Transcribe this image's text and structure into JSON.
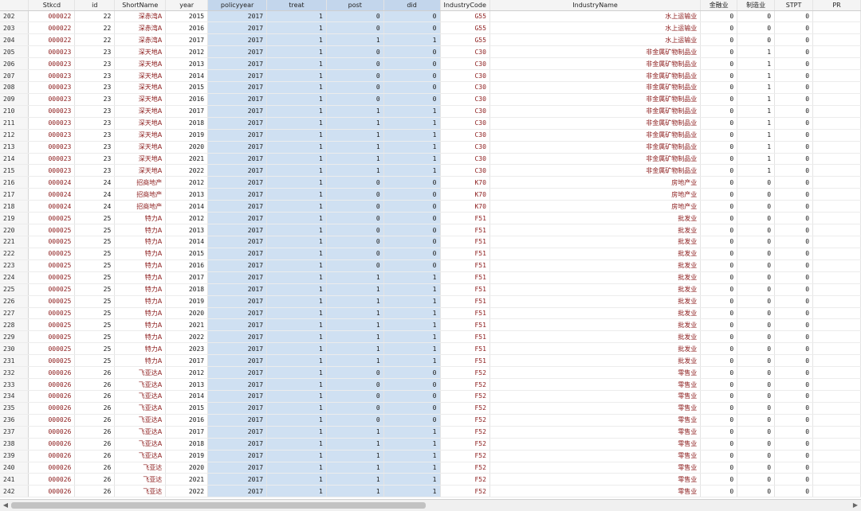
{
  "columns": [
    "",
    "Stkcd",
    "id",
    "ShortName",
    "year",
    "policyyear",
    "treat",
    "post",
    "did",
    "IndustryCode",
    "IndustryName",
    "金融业",
    "制造业",
    "STPT",
    "PR"
  ],
  "rows": [
    [
      "202",
      "000022",
      "22",
      "深赤湾A",
      "2015",
      "2017",
      "1",
      "0",
      "0",
      "G55",
      "水上运输业",
      "0",
      "0",
      "0"
    ],
    [
      "203",
      "000022",
      "22",
      "深赤湾A",
      "2016",
      "2017",
      "1",
      "0",
      "0",
      "G55",
      "水上运输业",
      "0",
      "0",
      "0"
    ],
    [
      "204",
      "000022",
      "22",
      "深赤湾A",
      "2017",
      "2017",
      "1",
      "1",
      "1",
      "G55",
      "水上运输业",
      "0",
      "0",
      "0"
    ],
    [
      "205",
      "000023",
      "23",
      "深天地A",
      "2012",
      "2017",
      "1",
      "0",
      "0",
      "C30",
      "非金属矿物制品业",
      "0",
      "1",
      "0"
    ],
    [
      "206",
      "000023",
      "23",
      "深天地A",
      "2013",
      "2017",
      "1",
      "0",
      "0",
      "C30",
      "非金属矿物制品业",
      "0",
      "1",
      "0"
    ],
    [
      "207",
      "000023",
      "23",
      "深天地A",
      "2014",
      "2017",
      "1",
      "0",
      "0",
      "C30",
      "非金属矿物制品业",
      "0",
      "1",
      "0"
    ],
    [
      "208",
      "000023",
      "23",
      "深天地A",
      "2015",
      "2017",
      "1",
      "0",
      "0",
      "C30",
      "非金属矿物制品业",
      "0",
      "1",
      "0"
    ],
    [
      "209",
      "000023",
      "23",
      "深天地A",
      "2016",
      "2017",
      "1",
      "0",
      "0",
      "C30",
      "非金属矿物制品业",
      "0",
      "1",
      "0"
    ],
    [
      "210",
      "000023",
      "23",
      "深天地A",
      "2017",
      "2017",
      "1",
      "1",
      "1",
      "C30",
      "非金属矿物制品业",
      "0",
      "1",
      "0"
    ],
    [
      "211",
      "000023",
      "23",
      "深天地A",
      "2018",
      "2017",
      "1",
      "1",
      "1",
      "C30",
      "非金属矿物制品业",
      "0",
      "1",
      "0"
    ],
    [
      "212",
      "000023",
      "23",
      "深天地A",
      "2019",
      "2017",
      "1",
      "1",
      "1",
      "C30",
      "非金属矿物制品业",
      "0",
      "1",
      "0"
    ],
    [
      "213",
      "000023",
      "23",
      "深天地A",
      "2020",
      "2017",
      "1",
      "1",
      "1",
      "C30",
      "非金属矿物制品业",
      "0",
      "1",
      "0"
    ],
    [
      "214",
      "000023",
      "23",
      "深天地A",
      "2021",
      "2017",
      "1",
      "1",
      "1",
      "C30",
      "非金属矿物制品业",
      "0",
      "1",
      "0"
    ],
    [
      "215",
      "000023",
      "23",
      "深天地A",
      "2022",
      "2017",
      "1",
      "1",
      "1",
      "C30",
      "非金属矿物制品业",
      "0",
      "1",
      "0"
    ],
    [
      "216",
      "000024",
      "24",
      "招商地产",
      "2012",
      "2017",
      "1",
      "0",
      "0",
      "K70",
      "房地产业",
      "0",
      "0",
      "0"
    ],
    [
      "217",
      "000024",
      "24",
      "招商地产",
      "2013",
      "2017",
      "1",
      "0",
      "0",
      "K70",
      "房地产业",
      "0",
      "0",
      "0"
    ],
    [
      "218",
      "000024",
      "24",
      "招商地产",
      "2014",
      "2017",
      "1",
      "0",
      "0",
      "K70",
      "房地产业",
      "0",
      "0",
      "0"
    ],
    [
      "219",
      "000025",
      "25",
      "特力A",
      "2012",
      "2017",
      "1",
      "0",
      "0",
      "F51",
      "批发业",
      "0",
      "0",
      "0"
    ],
    [
      "220",
      "000025",
      "25",
      "特力A",
      "2013",
      "2017",
      "1",
      "0",
      "0",
      "F51",
      "批发业",
      "0",
      "0",
      "0"
    ],
    [
      "221",
      "000025",
      "25",
      "特力A",
      "2014",
      "2017",
      "1",
      "0",
      "0",
      "F51",
      "批发业",
      "0",
      "0",
      "0"
    ],
    [
      "222",
      "000025",
      "25",
      "特力A",
      "2015",
      "2017",
      "1",
      "0",
      "0",
      "F51",
      "批发业",
      "0",
      "0",
      "0"
    ],
    [
      "223",
      "000025",
      "25",
      "特力A",
      "2016",
      "2017",
      "1",
      "0",
      "0",
      "F51",
      "批发业",
      "0",
      "0",
      "0"
    ],
    [
      "224",
      "000025",
      "25",
      "特力A",
      "2017",
      "2017",
      "1",
      "1",
      "1",
      "F51",
      "批发业",
      "0",
      "0",
      "0"
    ],
    [
      "225",
      "000025",
      "25",
      "特力A",
      "2018",
      "2017",
      "1",
      "1",
      "1",
      "F51",
      "批发业",
      "0",
      "0",
      "0"
    ],
    [
      "226",
      "000025",
      "25",
      "特力A",
      "2019",
      "2017",
      "1",
      "1",
      "1",
      "F51",
      "批发业",
      "0",
      "0",
      "0"
    ],
    [
      "227",
      "000025",
      "25",
      "特力A",
      "2020",
      "2017",
      "1",
      "1",
      "1",
      "F51",
      "批发业",
      "0",
      "0",
      "0"
    ],
    [
      "228",
      "000025",
      "25",
      "特力A",
      "2021",
      "2017",
      "1",
      "1",
      "1",
      "F51",
      "批发业",
      "0",
      "0",
      "0"
    ],
    [
      "229",
      "000025",
      "25",
      "特力A",
      "2022",
      "2017",
      "1",
      "1",
      "1",
      "F51",
      "批发业",
      "0",
      "0",
      "0"
    ],
    [
      "230",
      "000025",
      "25",
      "特力A",
      "2023",
      "2017",
      "1",
      "1",
      "1",
      "F51",
      "批发业",
      "0",
      "0",
      "0"
    ],
    [
      "231",
      "000025",
      "25",
      "特力A",
      "2017",
      "2017",
      "1",
      "1",
      "1",
      "F51",
      "批发业",
      "0",
      "0",
      "0"
    ],
    [
      "232",
      "000026",
      "26",
      "飞亚达A",
      "2012",
      "2017",
      "1",
      "0",
      "0",
      "F52",
      "零售业",
      "0",
      "0",
      "0"
    ],
    [
      "233",
      "000026",
      "26",
      "飞亚达A",
      "2013",
      "2017",
      "1",
      "0",
      "0",
      "F52",
      "零售业",
      "0",
      "0",
      "0"
    ],
    [
      "234",
      "000026",
      "26",
      "飞亚达A",
      "2014",
      "2017",
      "1",
      "0",
      "0",
      "F52",
      "零售业",
      "0",
      "0",
      "0"
    ],
    [
      "235",
      "000026",
      "26",
      "飞亚达A",
      "2015",
      "2017",
      "1",
      "0",
      "0",
      "F52",
      "零售业",
      "0",
      "0",
      "0"
    ],
    [
      "236",
      "000026",
      "26",
      "飞亚达A",
      "2016",
      "2017",
      "1",
      "0",
      "0",
      "F52",
      "零售业",
      "0",
      "0",
      "0"
    ],
    [
      "237",
      "000026",
      "26",
      "飞亚达A",
      "2017",
      "2017",
      "1",
      "1",
      "1",
      "F52",
      "零售业",
      "0",
      "0",
      "0"
    ],
    [
      "238",
      "000026",
      "26",
      "飞亚达A",
      "2018",
      "2017",
      "1",
      "1",
      "1",
      "F52",
      "零售业",
      "0",
      "0",
      "0"
    ],
    [
      "239",
      "000026",
      "26",
      "飞亚达A",
      "2019",
      "2017",
      "1",
      "1",
      "1",
      "F52",
      "零售业",
      "0",
      "0",
      "0"
    ],
    [
      "240",
      "000026",
      "26",
      "飞亚达",
      "2020",
      "2017",
      "1",
      "1",
      "1",
      "F52",
      "零售业",
      "0",
      "0",
      "0"
    ],
    [
      "241",
      "000026",
      "26",
      "飞亚达",
      "2021",
      "2017",
      "1",
      "1",
      "1",
      "F52",
      "零售业",
      "0",
      "0",
      "0"
    ],
    [
      "242",
      "000026",
      "26",
      "飞亚达",
      "2022",
      "2017",
      "1",
      "1",
      "1",
      "F52",
      "零售业",
      "0",
      "0",
      "0"
    ]
  ],
  "colors": {
    "string_text": "#8b1a1a",
    "selected_bg": "#cfe0f2"
  },
  "icons": {
    "scroll_left": "triangle-left-icon",
    "scroll_right": "triangle-right-icon"
  }
}
